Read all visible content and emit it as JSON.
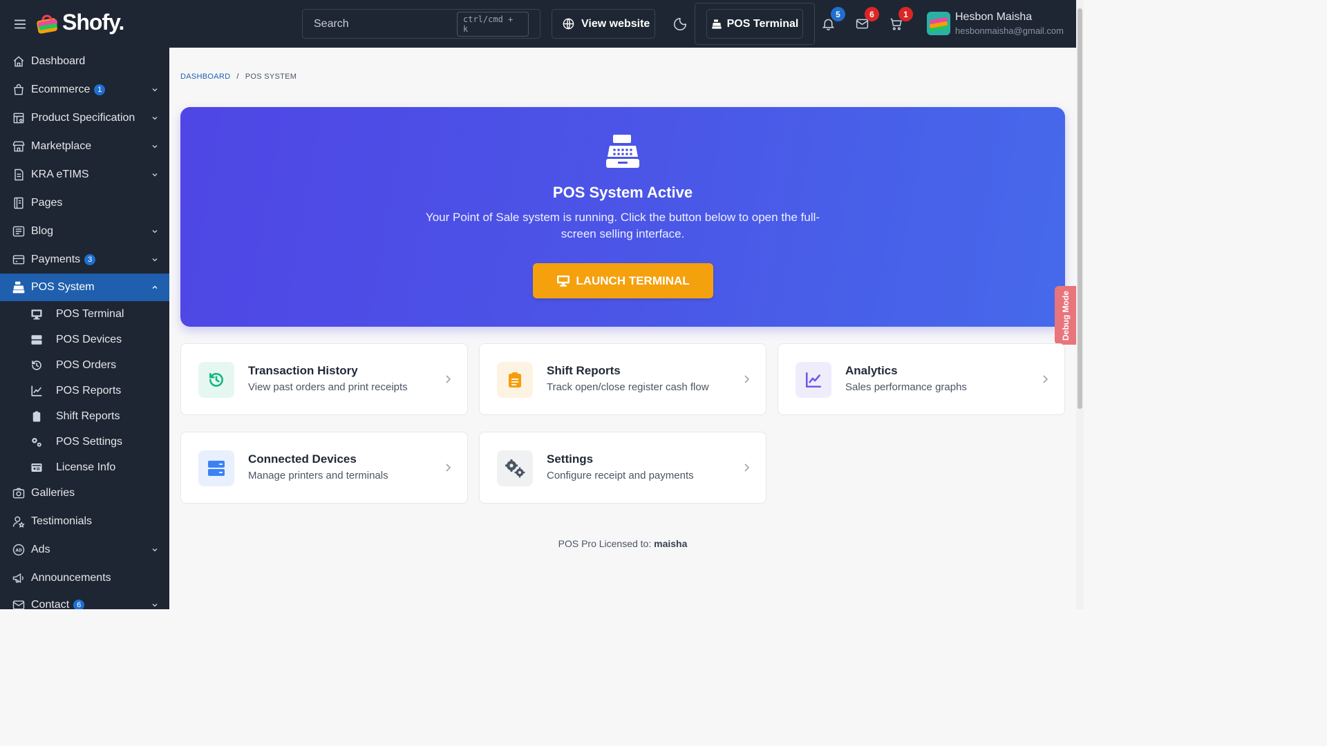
{
  "app": {
    "logo_text": "Shofy."
  },
  "header": {
    "search_placeholder": "Search",
    "search_shortcut": "ctrl/cmd + k",
    "view_website": "View website",
    "pos_terminal": "POS Terminal",
    "notifications_count": "5",
    "messages_count": "6",
    "cart_count": "1",
    "user_name": "Hesbon Maisha",
    "user_email": "hesbonmaisha@gmail.com"
  },
  "sidebar": {
    "items": [
      {
        "label": "Dashboard",
        "icon": "home-icon"
      },
      {
        "label": "Ecommerce",
        "badge": "1",
        "icon": "shopping-bag-icon"
      },
      {
        "label": "Product Specification",
        "icon": "table-settings-icon"
      },
      {
        "label": "Marketplace",
        "icon": "building-store-icon"
      },
      {
        "label": "KRA eTIMS",
        "icon": "receipt-icon"
      },
      {
        "label": "Pages",
        "icon": "notebook-icon"
      },
      {
        "label": "Blog",
        "icon": "article-icon"
      },
      {
        "label": "Payments",
        "badge": "3",
        "icon": "credit-card-icon"
      },
      {
        "label": "POS System",
        "icon": "cash-register-icon"
      }
    ],
    "pos_subitems": [
      {
        "label": "POS Terminal",
        "icon": "desktop-icon"
      },
      {
        "label": "POS Devices",
        "icon": "server-icon"
      },
      {
        "label": "POS Orders",
        "icon": "history-icon"
      },
      {
        "label": "POS Reports",
        "icon": "chart-line-icon"
      },
      {
        "label": "Shift Reports",
        "icon": "clipboard-icon"
      },
      {
        "label": "POS Settings",
        "icon": "cogs-icon"
      },
      {
        "label": "License Info",
        "icon": "id-card-icon"
      }
    ],
    "bottom_items": [
      {
        "label": "Galleries",
        "icon": "camera-icon"
      },
      {
        "label": "Testimonials",
        "icon": "user-star-icon"
      },
      {
        "label": "Ads",
        "icon": "ad-icon"
      },
      {
        "label": "Announcements",
        "icon": "speakerphone-icon"
      },
      {
        "label": "Contact",
        "badge": "6",
        "icon": "mail-icon"
      }
    ]
  },
  "breadcrumb": {
    "home": "DASHBOARD",
    "separator": "/",
    "current": "POS SYSTEM"
  },
  "hero": {
    "title": "POS System Active",
    "text": "Your Point of Sale system is running. Click the button below to open the full-screen selling interface.",
    "button": "LAUNCH TERMINAL"
  },
  "cards": [
    {
      "title": "Transaction History",
      "subtitle": "View past orders and print receipts",
      "icon": "history-icon"
    },
    {
      "title": "Shift Reports",
      "subtitle": "Track open/close register cash flow",
      "icon": "clipboard-list-icon"
    },
    {
      "title": "Analytics",
      "subtitle": "Sales performance graphs",
      "icon": "chart-line-icon"
    },
    {
      "title": "Connected Devices",
      "subtitle": "Manage printers and terminals",
      "icon": "server-icon"
    },
    {
      "title": "Settings",
      "subtitle": "Configure receipt and payments",
      "icon": "cogs-icon"
    }
  ],
  "license": {
    "prefix": "POS Pro Licensed to:",
    "name": "maisha"
  },
  "debug_label": "Debug Mode",
  "colors": {
    "header_bg": "#1e2633",
    "sidebar_active": "#1f5fae",
    "hero_start": "#4f46e5",
    "hero_end": "#4669ea",
    "launch_button": "#f5a00d",
    "badge_blue": "#1f6fd1",
    "badge_red": "#dc2626"
  }
}
